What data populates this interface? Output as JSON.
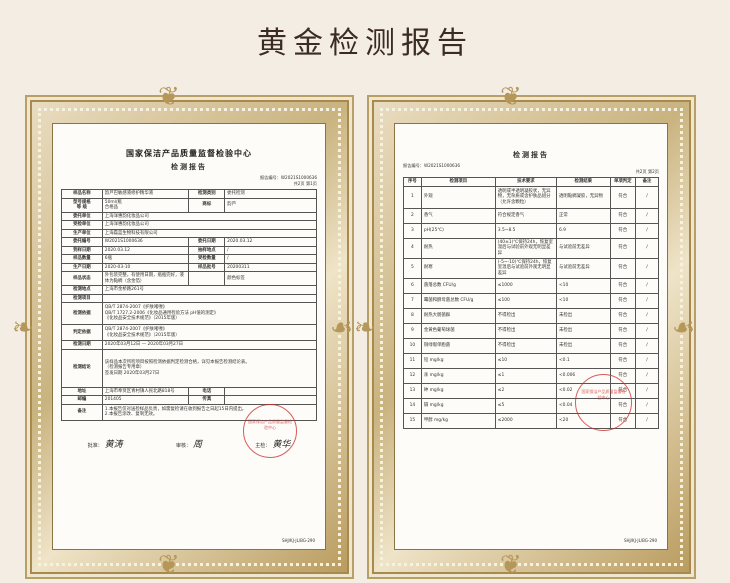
{
  "page_title": "黄金检测报告",
  "left_report": {
    "org_name": "国家保洁产品质量监督检验中心",
    "report_heading": "检测报告",
    "report_no": "报告编号：W2021S1000636",
    "pages": "共2页 第1页",
    "rows": [
      {
        "label": "样品名称",
        "value": "韵芦巴敏感液修护精华液",
        "label2": "检测类别",
        "value2": "委托检测"
      },
      {
        "label": "型号规格\n等 级",
        "value": "50ml/瓶\n合格品",
        "label2": "商标",
        "value2": "韵芦"
      },
      {
        "label": "委托单位",
        "value": "上海洋惠韵化妆品公司"
      },
      {
        "label": "受检单位",
        "value": "上海洋惠韵化妆品公司"
      },
      {
        "label": "生产单位",
        "value": "上海磊蓝生物科技有限公司"
      },
      {
        "label": "委托编号",
        "value": "W2021S1000636",
        "label2": "委托日期",
        "value2": "2020.03.12"
      },
      {
        "label": "到样日期",
        "value": "2020.03.12",
        "label2": "抽样地点",
        "value2": "/"
      },
      {
        "label": "样品数量",
        "value": "6瓶",
        "label2": "受检数量",
        "value2": "/"
      },
      {
        "label": "生产日期",
        "value": "2020-03-10",
        "label2": "样品批号",
        "value2": "20200311"
      },
      {
        "label": "样品状态",
        "value": "外包装完整，有使用日期，瓶瓶完好，液体为黏稠（含金箔）",
        "label2": "",
        "value2": "颜色标签"
      },
      {
        "label": "检测地点",
        "value": "上海市金桥路261号"
      },
      {
        "label": "检测项目",
        "value": ""
      },
      {
        "label": "检测依据",
        "value": "QB/T 2874-2007《护肤啫喱》\nQB/T 1727.2-2006《化妆品通用检验方法 pH值的测定》\n《化妆品安全技术规范》（2015年版）"
      },
      {
        "label": "判定依据",
        "value": "QB/T 2874-2007《护肤啫喱》\n《化妆品安全技术规范》（2015年版）"
      },
      {
        "label": "检测日期",
        "value": "2020年03月12日 — 2020年03月27日"
      },
      {
        "label": "检测结论",
        "value": "该样品本次所检项目按照检测依据判定检测合格，详见本报告检测结论表。\n（检测报告专用章）\n签发日期 2020年03月27日"
      },
      {
        "label": "地址",
        "value": "上海市奉贤区青村镇人民北路818号",
        "label2": "电话",
        "value2": ""
      },
      {
        "label": "邮编",
        "value": "201405",
        "label2": "传真",
        "value2": ""
      },
      {
        "label": "备注",
        "value": "1.本报告仅对送检样品负责，如需复检请在收到报告之日起15日内提出。\n2.本报告涂改、复制无效。"
      }
    ],
    "sig_labels": [
      "批准：",
      "审核：",
      "主检："
    ],
    "sig_names": [
      "黄涛",
      "周",
      "黄华"
    ],
    "stamp_text": "国家保洁产品质量监督检验中心",
    "footer": "SHJ/KJ-JL/BG-290"
  },
  "right_report": {
    "report_heading": "检测报告",
    "report_no": "报告编号：W2021S1000636",
    "pages": "共2页 第2页",
    "headers": [
      "序号",
      "检测项目",
      "技术要求",
      "检测结果",
      "单项判定",
      "备注"
    ],
    "rows": [
      [
        "1",
        "外观",
        "透明或半透明凝胶状，无异物，无杂质或含护肤品组分（允许含颗粒）",
        "透明黏稠凝胶，无异物",
        "符合",
        "/"
      ],
      [
        "2",
        "香气",
        "符合规定香气",
        "正常",
        "符合",
        "/"
      ],
      [
        "3",
        "pH(25℃)",
        "3.5~8.5",
        "6.9",
        "符合",
        "/"
      ],
      [
        "4",
        "耐热",
        "(40±1)℃保持24h，恢复室温后与试验前外观无明显差异",
        "与试验前无差异",
        "符合",
        "/"
      ],
      [
        "5",
        "耐寒",
        "(-5~-10)℃保持24h，恢复室温后与试验前外观无明显差异",
        "与试验前无差异",
        "符合",
        "/"
      ],
      [
        "6",
        "菌落总数    CFU/g",
        "≤1000",
        "<10",
        "符合",
        "/"
      ],
      [
        "7",
        "霉菌和酵母菌总数    CFU/g",
        "≤100",
        "<10",
        "符合",
        "/"
      ],
      [
        "8",
        "耐热大肠菌群",
        "不得检出",
        "未检出",
        "符合",
        "/"
      ],
      [
        "9",
        "金黄色葡萄球菌",
        "不得检出",
        "未检出",
        "符合",
        "/"
      ],
      [
        "10",
        "铜绿假单胞菌",
        "不得检出",
        "未检出",
        "符合",
        "/"
      ],
      [
        "11",
        "铅    mg/kg",
        "≤10",
        "<0.1",
        "符合",
        "/"
      ],
      [
        "12",
        "汞    mg/kg",
        "≤1",
        "<0.006",
        "符合",
        "/"
      ],
      [
        "13",
        "砷    mg/kg",
        "≤2",
        "<0.02",
        "符合",
        "/"
      ],
      [
        "14",
        "镉    mg/kg",
        "≤5",
        "<0.04",
        "符合",
        "/"
      ],
      [
        "15",
        "甲醇    mg/kg",
        "≤2000",
        "<20",
        "符合",
        "/"
      ]
    ],
    "stamp_text": "国家保洁产品质量监督检验中心",
    "footer": "SHJ/KJ-JL/BG-290"
  }
}
